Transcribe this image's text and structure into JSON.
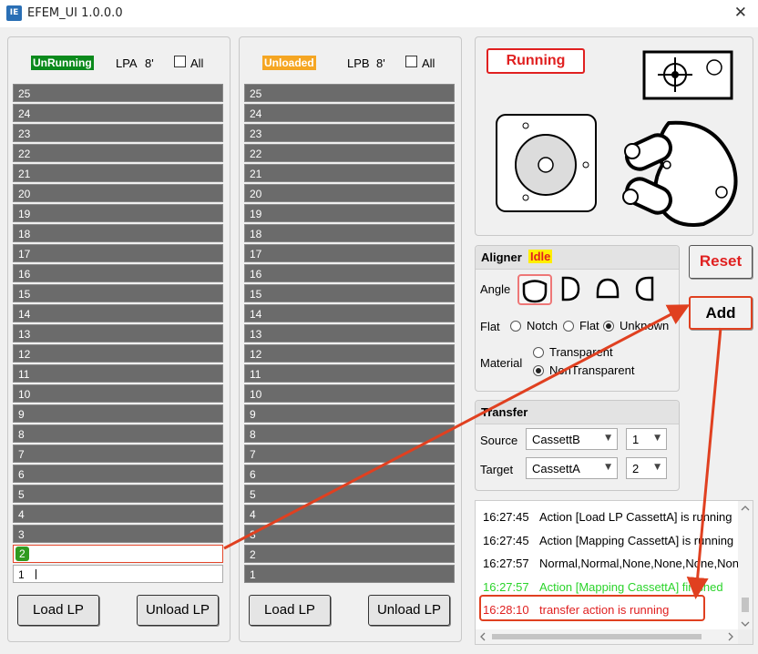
{
  "window": {
    "title": "EFEM_UI 1.0.0.0",
    "icon_text": "IE"
  },
  "lpa": {
    "status": "UnRunning",
    "label": "LPA",
    "size": "8'",
    "all_label": "All",
    "slots": [
      "25",
      "24",
      "23",
      "22",
      "21",
      "20",
      "19",
      "18",
      "17",
      "16",
      "15",
      "14",
      "13",
      "12",
      "11",
      "10",
      "9",
      "8",
      "7",
      "6",
      "5",
      "4",
      "3",
      "2",
      "1"
    ],
    "load_label": "Load LP",
    "unload_label": "Unload LP"
  },
  "lpb": {
    "status": "Unloaded",
    "label": "LPB",
    "size": "8'",
    "all_label": "All",
    "slots": [
      "25",
      "24",
      "23",
      "22",
      "21",
      "20",
      "19",
      "18",
      "17",
      "16",
      "15",
      "14",
      "13",
      "12",
      "11",
      "10",
      "9",
      "8",
      "7",
      "6",
      "5",
      "4",
      "3",
      "2",
      "1"
    ],
    "load_label": "Load LP",
    "unload_label": "Unload LP"
  },
  "robot": {
    "status": "Running"
  },
  "aligner": {
    "title": "Aligner",
    "status": "Idle",
    "angle_label": "Angle",
    "flat_label": "Flat",
    "flat_options": [
      "Notch",
      "Flat",
      "Unknown"
    ],
    "flat_selected": "Unknown",
    "material_label": "Material",
    "material_options": [
      "Transparent",
      "NonTransparent"
    ],
    "material_selected": "NonTransparent"
  },
  "transfer": {
    "title": "Transfer",
    "source_label": "Source",
    "source_value": "CassettB",
    "source_slot": "1",
    "target_label": "Target",
    "target_value": "CassettA",
    "target_slot": "2"
  },
  "buttons": {
    "reset": "Reset",
    "add": "Add"
  },
  "log": [
    {
      "time": "16:27:45",
      "msg": "Action [Load LP CassettA] is running",
      "color": "#000000"
    },
    {
      "time": "16:27:45",
      "msg": "Action [Mapping CassettA] is running",
      "color": "#000000"
    },
    {
      "time": "16:27:57",
      "msg": "Normal,Normal,None,None,None,None",
      "color": "#000000"
    },
    {
      "time": "16:27:57",
      "msg": "Action [Mapping CassettA] finished",
      "color": "#2bd42b"
    },
    {
      "time": "16:28:10",
      "msg": "transfer action is running",
      "color": "#e02020"
    }
  ],
  "colors": {
    "accent_red": "#e04020",
    "wafer_green": "#2f9a1f",
    "slot_gray": "#6b6b6b"
  }
}
